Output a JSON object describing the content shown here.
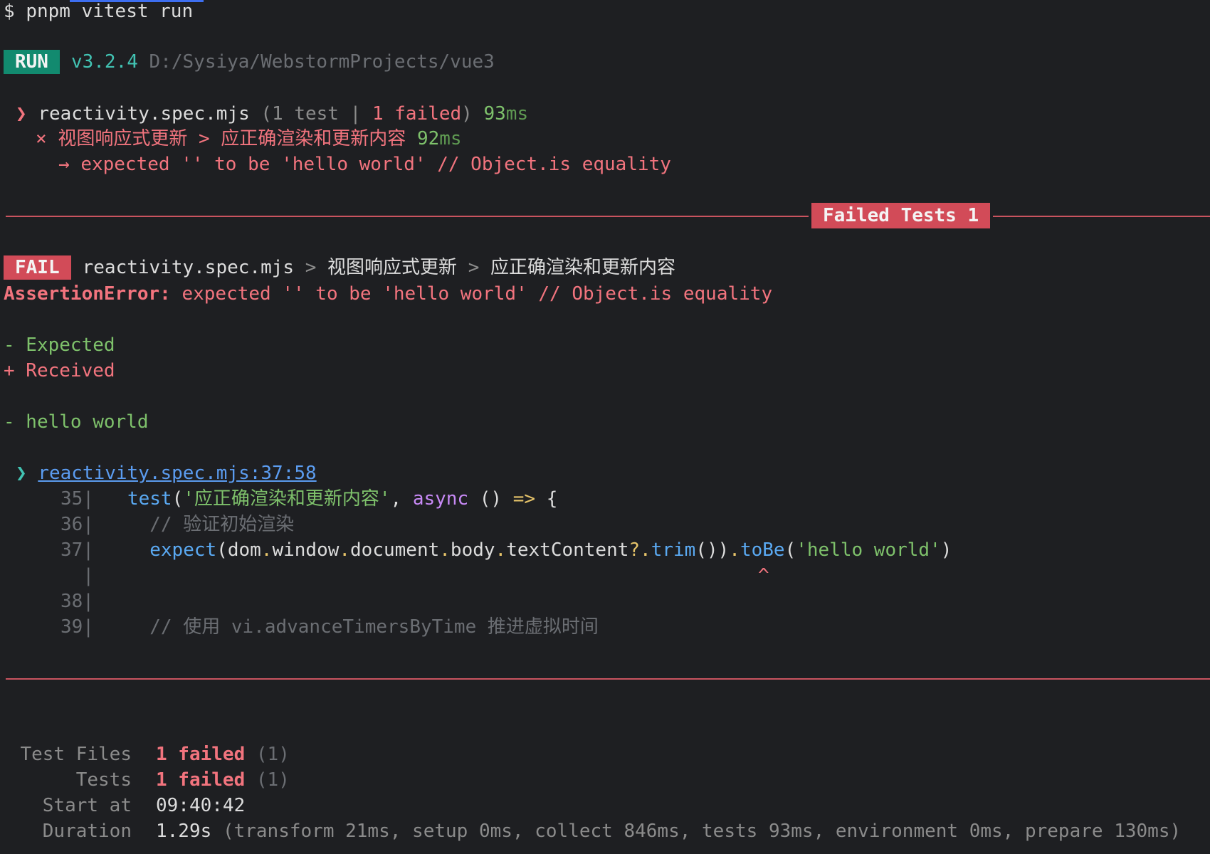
{
  "prompt": {
    "symbol": "$",
    "command": "pnpm vitest run"
  },
  "run": {
    "badge": "RUN",
    "version": "v3.2.4",
    "path": "D:/Sysiya/WebstormProjects/vue3"
  },
  "file_summary": {
    "marker": "❯",
    "file": "reactivity.spec.mjs",
    "open": "(1 test |",
    "failed": "1 failed",
    "close": ")",
    "time_num": "93",
    "time_unit": "ms"
  },
  "failed_case": {
    "marker": "×",
    "suite": "视图响应式更新",
    "sep": ">",
    "name": "应正确渲染和更新内容",
    "time_num": "92",
    "time_unit": "ms"
  },
  "failed_msg": {
    "arrow": "→",
    "text": "expected '' to be 'hello world' // Object.is equality"
  },
  "banner": "Failed Tests 1",
  "fail_header": {
    "badge": "FAIL",
    "file": "reactivity.spec.mjs",
    "sep1": ">",
    "suite": "视图响应式更新",
    "sep2": ">",
    "name": "应正确渲染和更新内容"
  },
  "assertion": {
    "label": "AssertionError:",
    "message": "expected '' to be 'hello world' // Object.is equality"
  },
  "diff": {
    "expected_legend": "- Expected",
    "received_legend": "+ Received",
    "line": "- hello world"
  },
  "location": {
    "marker": "❯",
    "link": "reactivity.spec.mjs:37:58"
  },
  "code": {
    "l35": {
      "num": "35|",
      "fn": "test",
      "p1": "(",
      "str": "'应正确渲染和更新内容'",
      "p2": ",",
      "kw": "async",
      "p3": " ()",
      "arrow": "=>",
      "p4": "{"
    },
    "l36": {
      "num": "36|",
      "comment": "// 验证初始渲染"
    },
    "l37": {
      "num": "37|",
      "fn": "expect",
      "p1": "(dom",
      "d1": ".",
      "w": "window",
      "d2": ".",
      "doc": "document",
      "d3": ".",
      "body": "body",
      "d4": ".",
      "tc": "textContent",
      "opt": "?.",
      "trim": "trim",
      "p2": "())",
      "d5": ".",
      "tobe": "toBe",
      "p3": "(",
      "str": "'hello world'",
      "p4": ")"
    },
    "caret": {
      "bar": "|",
      "mark": "^"
    },
    "l38": {
      "num": "38|"
    },
    "l39": {
      "num": "39|",
      "comment": "// 使用 vi.advanceTimersByTime 推进虚拟时间"
    }
  },
  "summary": {
    "files_label": "Test Files",
    "files_failed": "1 failed",
    "files_total": "(1)",
    "tests_label": "Tests",
    "tests_failed": "1 failed",
    "tests_total": "(1)",
    "start_label": "Start at",
    "start_value": "09:40:42",
    "duration_label": "Duration",
    "duration_value": "1.29s",
    "duration_detail": "(transform 21ms, setup 0ms, collect 846ms, tests 93ms, environment 0ms, prepare 130ms)"
  },
  "colors": {
    "background": "#1e1f22",
    "fail_red": "#d24b58",
    "run_green": "#128a6f",
    "pass_green": "#7ec16b"
  }
}
